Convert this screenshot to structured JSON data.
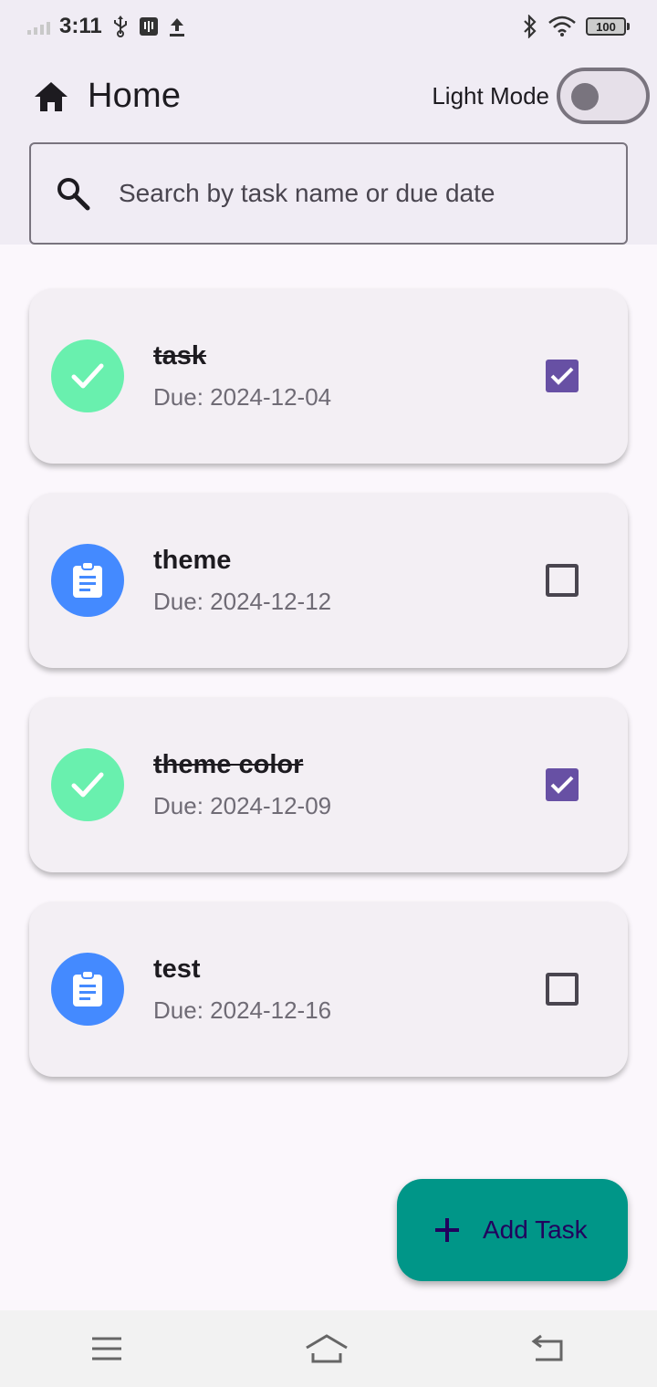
{
  "status_bar": {
    "time": "3:11",
    "battery": "100",
    "icons": [
      "signal-icon",
      "usb-icon",
      "usb-debug-icon",
      "upload-icon",
      "bluetooth-icon",
      "wifi-icon",
      "battery-icon"
    ]
  },
  "header": {
    "title": "Home",
    "mode_label": "Light Mode",
    "mode_toggle_on": false
  },
  "search": {
    "placeholder": "Search by task name or due date"
  },
  "tasks": [
    {
      "title": "task",
      "due": "Due: 2024-12-04",
      "completed": true,
      "icon": "check-icon",
      "avatar_color": "#69f0ae"
    },
    {
      "title": "theme",
      "due": "Due: 2024-12-12",
      "completed": false,
      "icon": "clipboard-icon",
      "avatar_color": "#448aff"
    },
    {
      "title": "theme color",
      "due": "Due: 2024-12-09",
      "completed": true,
      "icon": "check-icon",
      "avatar_color": "#69f0ae"
    },
    {
      "title": "test",
      "due": "Due: 2024-12-16",
      "completed": false,
      "icon": "clipboard-icon",
      "avatar_color": "#448aff"
    }
  ],
  "fab": {
    "label": "Add Task",
    "icon": "plus-icon"
  },
  "colors": {
    "header_bg": "#f0ecf4",
    "page_bg": "#fbf7fc",
    "card_bg": "#f3eff4",
    "fab_bg": "#009688",
    "checkbox_accent": "#6750a4"
  },
  "nav": [
    "menu-icon",
    "home-nav-icon",
    "back-icon"
  ]
}
